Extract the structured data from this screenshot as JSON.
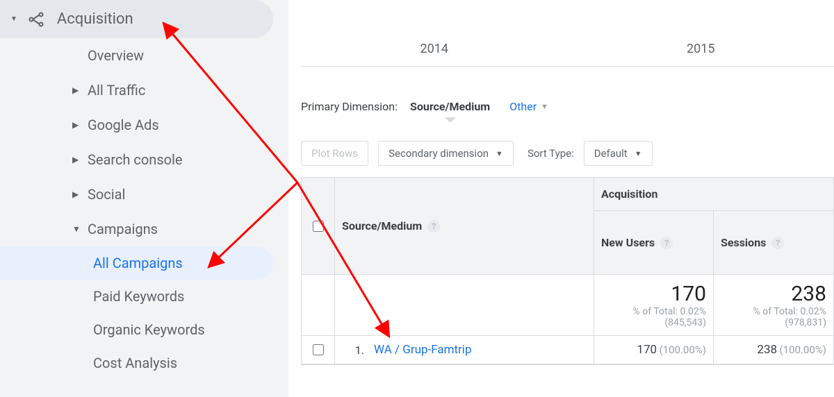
{
  "sidebar": {
    "header": "Acquisition",
    "items": [
      {
        "label": "Overview",
        "has_children": false
      },
      {
        "label": "All Traffic",
        "has_children": true
      },
      {
        "label": "Google Ads",
        "has_children": true
      },
      {
        "label": "Search console",
        "has_children": true
      },
      {
        "label": "Social",
        "has_children": true
      },
      {
        "label": "Campaigns",
        "has_children": true,
        "expanded": true
      }
    ],
    "campaigns_sub": [
      {
        "label": "All Campaigns",
        "active": true
      },
      {
        "label": "Paid Keywords",
        "active": false
      },
      {
        "label": "Organic Keywords",
        "active": false
      },
      {
        "label": "Cost Analysis",
        "active": false
      }
    ]
  },
  "years": {
    "a": "2014",
    "b": "2015"
  },
  "primary_dimension": {
    "label": "Primary Dimension:",
    "value": "Source/Medium",
    "other_label": "Other"
  },
  "toolbar": {
    "plot_rows": "Plot Rows",
    "secondary_dimension": "Secondary dimension",
    "sort_type_label": "Sort Type:",
    "sort_default": "Default"
  },
  "table": {
    "group_acquisition": "Acquisition",
    "col_source_medium": "Source/Medium",
    "col_new_users": "New Users",
    "col_sessions": "Sessions",
    "summary": {
      "new_users_value": "170",
      "new_users_sub1": "% of Total: 0.02%",
      "new_users_sub2": "(845,543)",
      "sessions_value": "238",
      "sessions_sub1": "% of Total: 0.02%",
      "sessions_sub2": "(978,831)"
    },
    "rows": [
      {
        "index": "1.",
        "source_medium": "WA / Grup-Famtrip",
        "new_users": "170",
        "new_users_pct": "(100.00%)",
        "sessions": "238",
        "sessions_pct": "(100.00%)"
      }
    ]
  }
}
